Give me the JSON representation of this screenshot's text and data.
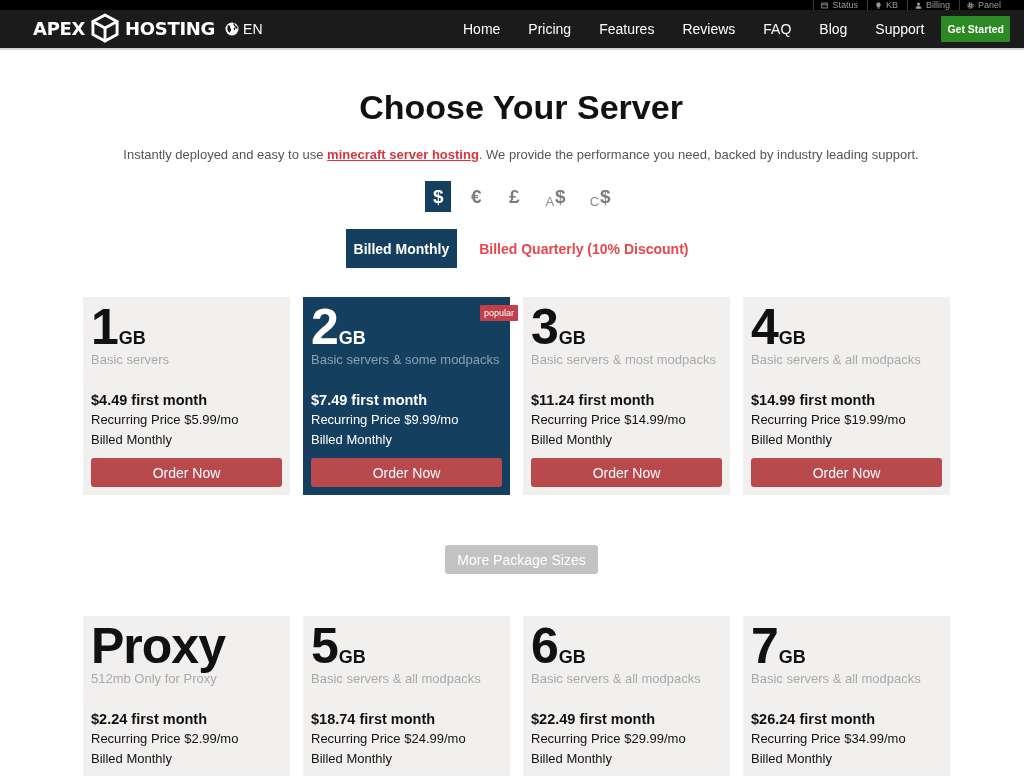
{
  "utility_links": [
    {
      "label": "Status"
    },
    {
      "label": "KB"
    },
    {
      "label": "Billing"
    },
    {
      "label": "Panel"
    }
  ],
  "header": {
    "logo": {
      "left": "APEX",
      "right": "HOSTING"
    },
    "language": "EN",
    "nav": [
      "Home",
      "Pricing",
      "Features",
      "Reviews",
      "FAQ",
      "Blog",
      "Support"
    ],
    "cta": "Get Started"
  },
  "hero": {
    "title": "Choose Your Server",
    "intro": {
      "before": "Instantly deployed and easy to use ",
      "link": "minecraft server hosting",
      "after": ". We provide the performance you need, backed by industry leading support."
    }
  },
  "currencies": [
    {
      "symbol": "$",
      "selected": true
    },
    {
      "symbol": "€",
      "selected": false
    },
    {
      "symbol": "£",
      "selected": false
    },
    {
      "prefix": "A",
      "symbol": "$",
      "selected": false
    },
    {
      "prefix": "C",
      "symbol": "$",
      "selected": false
    }
  ],
  "billing_options": [
    {
      "label": "Billed Monthly",
      "selected": true
    },
    {
      "label": "Billed Quarterly (10% Discount)",
      "selected": false
    }
  ],
  "plans": [
    {
      "size": "1",
      "unit": "GB",
      "description": "Basic servers",
      "first_month": "$4.49 first month",
      "recurring": "Recurring Price $5.99/mo",
      "billing": "Billed Monthly",
      "button": "Order Now",
      "featured": false
    },
    {
      "size": "2",
      "unit": "GB",
      "description": "Basic servers & some modpacks",
      "first_month": "$7.49 first month",
      "recurring": "Recurring Price $9.99/mo",
      "billing": "Billed Monthly",
      "button": "Order Now",
      "featured": true,
      "badge": "popular"
    },
    {
      "size": "3",
      "unit": "GB",
      "description": "Basic servers & most modpacks",
      "first_month": "$11.24 first month",
      "recurring": "Recurring Price $14.99/mo",
      "billing": "Billed Monthly",
      "button": "Order Now",
      "featured": false
    },
    {
      "size": "4",
      "unit": "GB",
      "description": "Basic servers & all modpacks",
      "first_month": "$14.99 first month",
      "recurring": "Recurring Price $19.99/mo",
      "billing": "Billed Monthly",
      "button": "Order Now",
      "featured": false
    }
  ],
  "more_button": "More Package Sizes",
  "more_plans": [
    {
      "size": "Proxy",
      "description": "512mb Only for Proxy",
      "first_month": "$2.24 first month",
      "recurring": "Recurring Price $2.99/mo",
      "billing": "Billed Monthly",
      "featured": false
    },
    {
      "size": "5",
      "unit": "GB",
      "description": "Basic servers & all modpacks",
      "first_month": "$18.74 first month",
      "recurring": "Recurring Price $24.99/mo",
      "billing": "Billed Monthly",
      "featured": false
    },
    {
      "size": "6",
      "unit": "GB",
      "description": "Basic servers & all modpacks",
      "first_month": "$22.49 first month",
      "recurring": "Recurring Price $29.99/mo",
      "billing": "Billed Monthly",
      "featured": false
    },
    {
      "size": "7",
      "unit": "GB",
      "description": "Basic servers & all modpacks",
      "first_month": "$26.24 first month",
      "recurring": "Recurring Price $34.99/mo",
      "billing": "Billed Monthly",
      "featured": false
    }
  ]
}
